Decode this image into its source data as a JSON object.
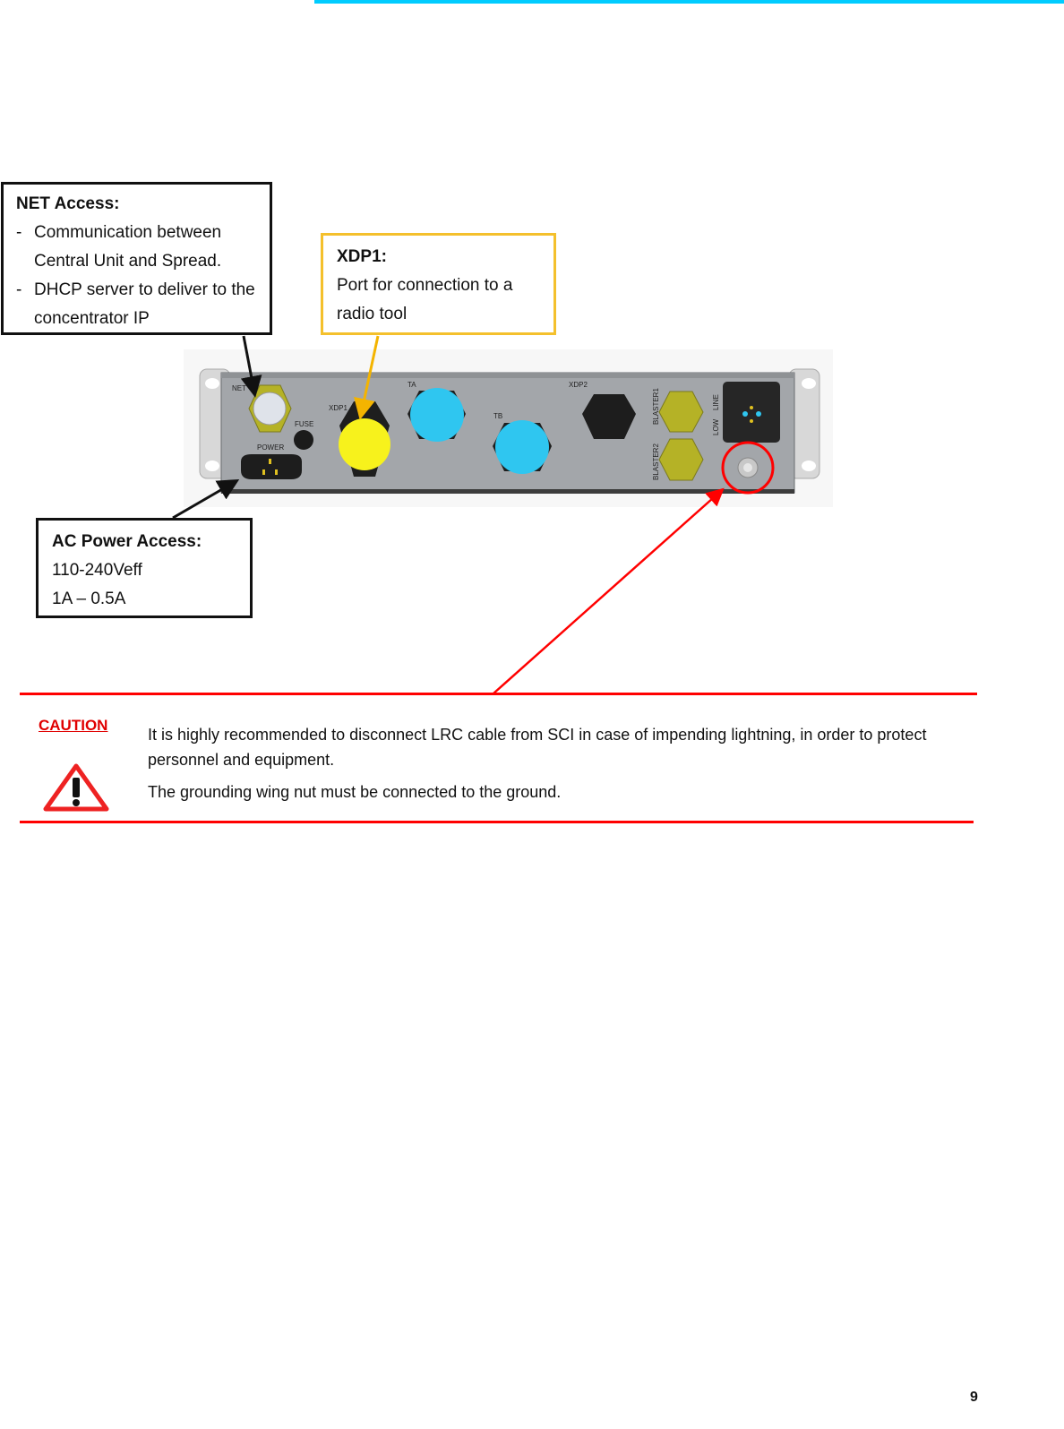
{
  "header": {
    "accent_color": "#00ccff"
  },
  "callouts": {
    "net": {
      "title": "NET Access:",
      "items": [
        "Communication between Central Unit and Spread.",
        "DHCP server to deliver to the concentrator IP"
      ]
    },
    "xdp1": {
      "title": "XDP1:",
      "text": "Port for connection to a radio tool",
      "border_color": "#f4c02c"
    },
    "ac_power": {
      "title": "AC Power Access:",
      "lines": [
        "110-240Veff",
        "1A – 0.5A"
      ]
    }
  },
  "panel": {
    "labels": {
      "net": "NET",
      "fuse": "FUSE",
      "power": "POWER",
      "xdp1": "XDP1",
      "ta": "TA",
      "tb": "TB",
      "xdp2": "XDP2",
      "blaster1": "BLASTER1",
      "blaster2": "BLASTER2",
      "low": "LOW",
      "line": "LINE"
    }
  },
  "caution": {
    "label": "CAUTION",
    "icon": "warning-triangle-icon",
    "color": "#ff0000",
    "paragraphs": [
      "It is highly recommended to disconnect LRC cable from SCI in case of impending lightning, in order to protect personnel and equipment.",
      "The grounding wing nut must be connected to the ground."
    ]
  },
  "footer": {
    "page_number": "9"
  }
}
